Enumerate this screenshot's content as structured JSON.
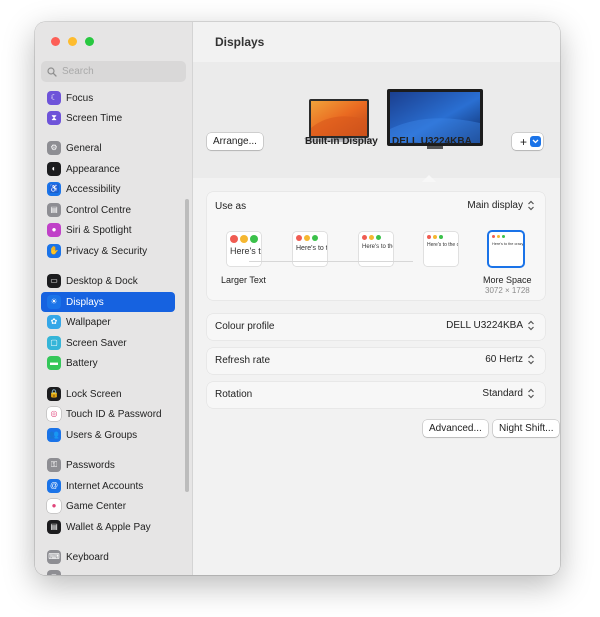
{
  "search": {
    "placeholder": "Search"
  },
  "colors": {
    "accent": "#1662e0",
    "sidebar_bg": "#e6e5e5"
  },
  "sidebar": {
    "items": [
      {
        "label": "Focus",
        "icon": "moon-icon",
        "color": "#6e53d9"
      },
      {
        "label": "Screen Time",
        "icon": "hourglass-icon",
        "color": "#6e53d9"
      },
      {
        "label": "General",
        "icon": "gear-icon",
        "color": "#8e8e93"
      },
      {
        "label": "Appearance",
        "icon": "appearance-icon",
        "color": "#1c1c1e"
      },
      {
        "label": "Accessibility",
        "icon": "accessibility-icon",
        "color": "#1a73e8"
      },
      {
        "label": "Control Centre",
        "icon": "control-centre-icon",
        "color": "#8e8e93"
      },
      {
        "label": "Siri & Spotlight",
        "icon": "siri-icon",
        "color": "#c040c8"
      },
      {
        "label": "Privacy & Security",
        "icon": "hand-icon",
        "color": "#1a73e8"
      },
      {
        "label": "Desktop & Dock",
        "icon": "dock-icon",
        "color": "#1c1c1e"
      },
      {
        "label": "Displays",
        "icon": "sun-icon",
        "color": "#1a73e8"
      },
      {
        "label": "Wallpaper",
        "icon": "flower-icon",
        "color": "#35a7e8"
      },
      {
        "label": "Screen Saver",
        "icon": "screen-saver-icon",
        "color": "#35b5d8"
      },
      {
        "label": "Battery",
        "icon": "battery-icon",
        "color": "#34c759"
      },
      {
        "label": "Lock Screen",
        "icon": "lock-icon",
        "color": "#1c1c1e"
      },
      {
        "label": "Touch ID & Password",
        "icon": "fingerprint-icon",
        "color": "#ffffff"
      },
      {
        "label": "Users & Groups",
        "icon": "users-icon",
        "color": "#1a73e8"
      },
      {
        "label": "Passwords",
        "icon": "key-icon",
        "color": "#8e8e93"
      },
      {
        "label": "Internet Accounts",
        "icon": "at-icon",
        "color": "#1a73e8"
      },
      {
        "label": "Game Center",
        "icon": "game-center-icon",
        "color": "#ffffff"
      },
      {
        "label": "Wallet & Apple Pay",
        "icon": "wallet-icon",
        "color": "#1c1c1e"
      },
      {
        "label": "Keyboard",
        "icon": "keyboard-icon",
        "color": "#8e8e93"
      },
      {
        "label": "",
        "icon": "mouse-icon",
        "color": "#8e8e93"
      }
    ]
  },
  "page": {
    "title": "Displays"
  },
  "arrangement": {
    "arrange_label": "Arrange...",
    "add_label": "+",
    "displays": [
      {
        "name": "Built-in Display"
      },
      {
        "name": "DELL U3224KBA"
      }
    ]
  },
  "use_as": {
    "label": "Use as",
    "value": "Main display"
  },
  "resolution": {
    "tile_text": "Here's to the crazy ones who see things differently. The troublemakers, the rebels.",
    "left_caption": "Larger Text",
    "right_caption": "More Space",
    "right_sub": "3072 × 1728",
    "selected_index": 4
  },
  "settings": [
    {
      "label": "Colour profile",
      "value": "DELL U3224KBA"
    },
    {
      "label": "Refresh rate",
      "value": "60 Hertz"
    },
    {
      "label": "Rotation",
      "value": "Standard"
    }
  ],
  "footer": {
    "advanced_label": "Advanced...",
    "night_shift_label": "Night Shift...",
    "help_label": "?"
  }
}
